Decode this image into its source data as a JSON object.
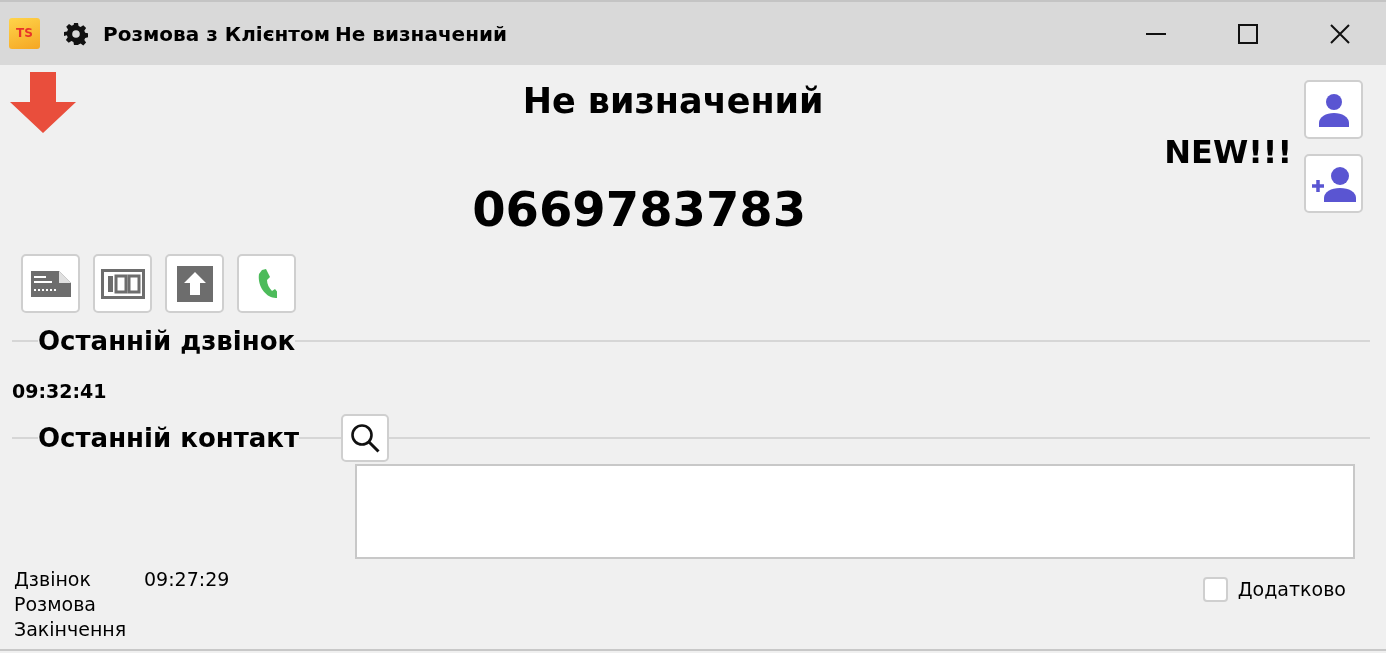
{
  "window": {
    "logo": "TS",
    "title": "Розмова з Клієнтом",
    "subtitle": "Не визначений"
  },
  "caller": {
    "name": "Не визначений",
    "phone": "0669783783",
    "badge": "NEW!!!"
  },
  "last_call": {
    "heading": "Останній дзвінок",
    "time": "09:32:41"
  },
  "last_contact": {
    "heading": "Останній контакт"
  },
  "call_times": [
    {
      "label": "Дзвінок",
      "value": "09:27:29"
    },
    {
      "label": "Розмова"
    },
    {
      "label": "Закінчення"
    }
  ],
  "extra": {
    "label": "Додатково",
    "checked": false
  }
}
